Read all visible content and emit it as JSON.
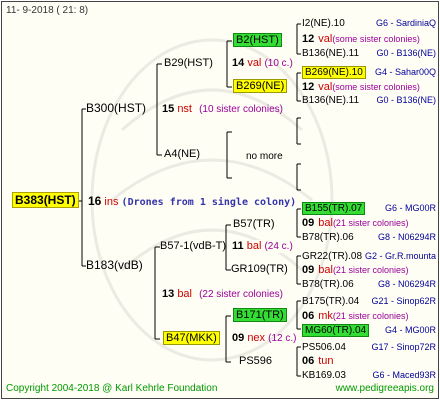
{
  "date_stamp": "11-  9-2018 ( 21:  8)",
  "root": {
    "name": "B383(HST)",
    "gen": "16",
    "gen_text": "ins",
    "note": "(Drones from 1 single colony)"
  },
  "sire": {
    "name": "B300(HST)",
    "gen": "15",
    "gen_text": "nst",
    "note": "(10 sister colonies)"
  },
  "dam": {
    "name": "B183(vdB)",
    "gen": "13",
    "gen_text": "bal",
    "note": "(22 sister colonies)"
  },
  "ss": {
    "name": "B29(HST)",
    "gen": "14",
    "gen_text": "val",
    "note": "(10 c.)"
  },
  "sd": {
    "name": "A4(NE)",
    "more": "no more"
  },
  "sss": {
    "name": "B2(HST)"
  },
  "ssd": {
    "name": "B269(NE)",
    "gen": "12",
    "gen_text": "val",
    "note": "(some sister colonies)"
  },
  "ds": {
    "name": "B57-1(vdB-T)",
    "gen": "11",
    "gen_text": "bal",
    "note": "(24 c.)"
  },
  "dd": {
    "name": "B47(MKK)",
    "gen": "09",
    "gen_text": "nex",
    "note": "(12 c.)"
  },
  "dss": {
    "name": "B57(TR)"
  },
  "dsd": {
    "name": "GR109(TR)"
  },
  "dds": {
    "name": "B171(TR)"
  },
  "ddd": {
    "name": "PS596"
  },
  "right": [
    {
      "name": "I2(NE).10",
      "info": "G6 - SardiniaQ"
    },
    {
      "num": "12",
      "txt": "val",
      "note": "(some sister colonies)"
    },
    {
      "name": "B136(NE).11",
      "info": "G0 - B136(NE)"
    },
    {
      "name": "B269(NE).10",
      "info": "G4 - Sahar00Q"
    },
    {
      "num": "12",
      "txt": "val",
      "note": "(some sister colonies)"
    },
    {
      "name": "B136(NE).11",
      "info": "G0 - B136(NE)"
    },
    {
      "name": "B155(TR).07",
      "info": "G6 - MG00R"
    },
    {
      "num": "09",
      "txt": "bal",
      "note": "(21 sister colonies)"
    },
    {
      "name": "B78(TR).06",
      "info": "G8 - N06294R"
    },
    {
      "name": "GR22(TR).08",
      "info": "G2 - Gr.R.mounta"
    },
    {
      "num": "09",
      "txt": "bal",
      "note": "(21 sister colonies)"
    },
    {
      "name": "B78(TR).06",
      "info": "G8 - N06294R"
    },
    {
      "name": "B175(TR).04",
      "info": "G21 - Sinop62R"
    },
    {
      "num": "06",
      "txt": "mk",
      "note": "(21 sister colonies)"
    },
    {
      "name": "MG60(TR).04",
      "info": "G4 - MG00R"
    },
    {
      "name": "PS506.04",
      "info": "G17 - Sinop72R"
    },
    {
      "num": "06",
      "txt": "tun",
      "note": ""
    },
    {
      "name": "KB169.03",
      "info": "G6 - Maced93R"
    }
  ],
  "footer_left": "Copyright 2004-2018 @ Karl Kehrle Foundation",
  "footer_right": "www.pedigreeapis.org"
}
